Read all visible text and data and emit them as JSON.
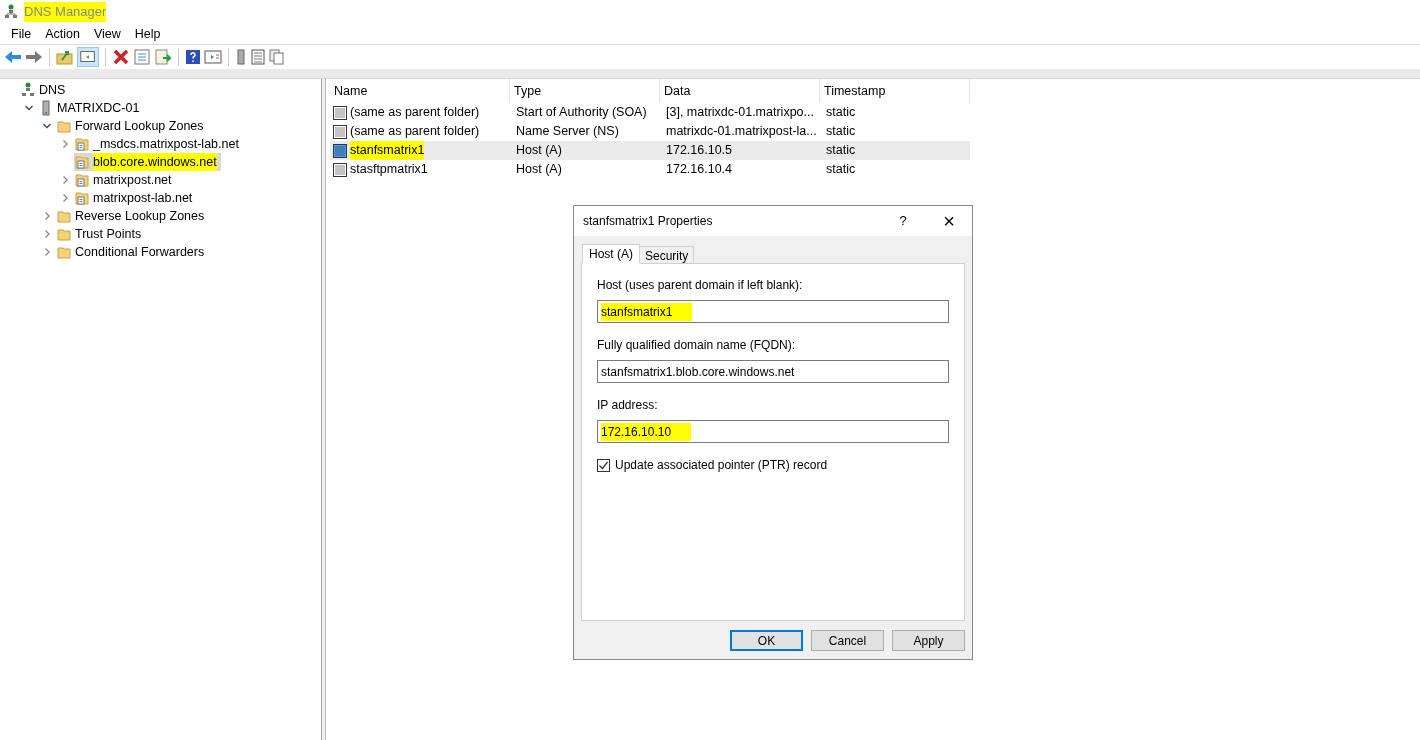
{
  "window": {
    "title": "DNS Manager",
    "title_highlighted": true
  },
  "menu": [
    "File",
    "Action",
    "View",
    "Help"
  ],
  "tree": [
    {
      "label": "DNS",
      "kind": "dns",
      "selected": false,
      "highlighted": false,
      "children": [
        {
          "label": "MATRIXDC-01",
          "kind": "server",
          "expanded": true,
          "selected": false,
          "highlighted": false,
          "children": [
            {
              "label": "Forward Lookup Zones",
              "kind": "folder",
              "expanded": true,
              "selected": false,
              "highlighted": false,
              "children": [
                {
                  "label": "_msdcs.matrixpost-lab.net",
                  "kind": "zone",
                  "expanded": false,
                  "selected": false,
                  "highlighted": false
                },
                {
                  "label": "blob.core.windows.net",
                  "kind": "zone",
                  "selected": true,
                  "highlighted": true
                },
                {
                  "label": "matrixpost.net",
                  "kind": "zone",
                  "expanded": false,
                  "selected": false,
                  "highlighted": false
                },
                {
                  "label": "matrixpost-lab.net",
                  "kind": "zone",
                  "expanded": false,
                  "selected": false,
                  "highlighted": false
                }
              ]
            },
            {
              "label": "Reverse Lookup Zones",
              "kind": "folder",
              "expanded": false,
              "selected": false,
              "highlighted": false
            },
            {
              "label": "Trust Points",
              "kind": "folder",
              "expanded": false,
              "selected": false,
              "highlighted": false
            },
            {
              "label": "Conditional Forwarders",
              "kind": "folder",
              "expanded": false,
              "selected": false,
              "highlighted": false
            }
          ]
        }
      ]
    }
  ],
  "table": {
    "columns": [
      "Name",
      "Type",
      "Data",
      "Timestamp"
    ],
    "rows": [
      {
        "cells": [
          "(same as parent folder)",
          "Start of Authority (SOA)",
          "[3], matrixdc-01.matrixpo...",
          "static"
        ],
        "selected": false,
        "highlighted": false
      },
      {
        "cells": [
          "(same as parent folder)",
          "Name Server (NS)",
          "matrixdc-01.matrixpost-la...",
          "static"
        ],
        "selected": false,
        "highlighted": false
      },
      {
        "cells": [
          "stanfsmatrix1",
          "Host (A)",
          "172.16.10.5",
          "static"
        ],
        "selected": true,
        "highlighted": true
      },
      {
        "cells": [
          "stasftpmatrix1",
          "Host (A)",
          "172.16.10.4",
          "static"
        ],
        "selected": false,
        "highlighted": false
      }
    ]
  },
  "dialog": {
    "title": "stanfsmatrix1 Properties",
    "help": "?",
    "close": "×",
    "tabs": [
      {
        "label": "Host (A)",
        "selected": true
      },
      {
        "label": "Security",
        "selected": false
      }
    ],
    "fields": [
      {
        "label": "Host (uses parent domain if left blank):",
        "value": "stanfsmatrix1",
        "highlighted": true
      },
      {
        "label": "Fully qualified domain name (FQDN):",
        "value": "stanfsmatrix1.blob.core.windows.net",
        "highlighted": false
      },
      {
        "label": "IP address:",
        "value": "172.16.10.10",
        "highlighted": true
      }
    ],
    "checkbox": {
      "label": "Update associated pointer (PTR) record",
      "checked": true
    },
    "buttons": [
      {
        "label": "OK",
        "default": true
      },
      {
        "label": "Cancel",
        "default": false
      },
      {
        "label": "Apply",
        "default": false
      }
    ]
  }
}
